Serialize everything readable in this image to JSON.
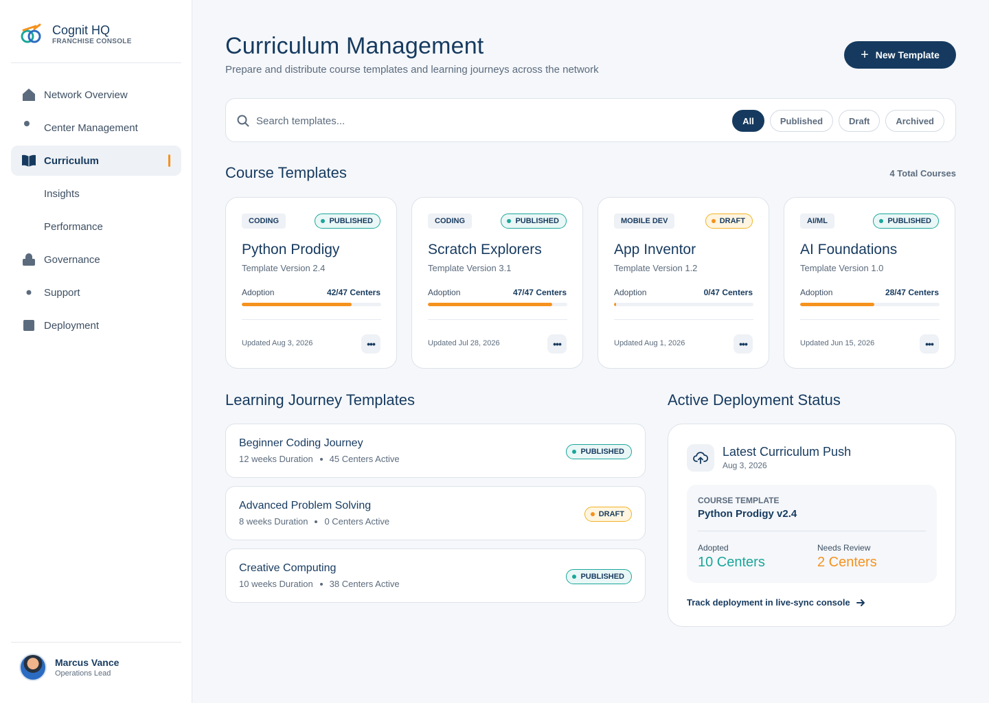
{
  "brand": {
    "title": "Cognit HQ",
    "subtitle": "FRANCHISE CONSOLE"
  },
  "sidebar": {
    "items": [
      {
        "label": "Network Overview",
        "icon": "home-icon"
      },
      {
        "label": "Center Management",
        "icon": "dot-icon"
      },
      {
        "label": "Curriculum",
        "icon": "book-icon",
        "active": true
      },
      {
        "label": "Insights",
        "icon": "none"
      },
      {
        "label": "Performance",
        "icon": "none"
      },
      {
        "label": "Governance",
        "icon": "lock-icon"
      },
      {
        "label": "Support",
        "icon": "dot-icon"
      },
      {
        "label": "Deployment",
        "icon": "square-icon"
      }
    ]
  },
  "user": {
    "name": "Marcus Vance",
    "role": "Operations Lead"
  },
  "header": {
    "title": "Curriculum Management",
    "subtitle": "Prepare and distribute course templates and learning journeys across the network",
    "new_button": "New Template"
  },
  "search": {
    "placeholder": "Search templates..."
  },
  "filters": [
    "All",
    "Published",
    "Draft",
    "Archived"
  ],
  "course_section": {
    "title": "Course Templates",
    "total": "4 Total Courses"
  },
  "courses": [
    {
      "tag": "CODING",
      "status": "PUBLISHED",
      "name": "Python Prodigy",
      "version": "Template Version 2.4",
      "adoption_label": "Adoption",
      "adoption": "42/47 Centers",
      "adoption_fraction": 0.79,
      "updated": "Updated Aug 3, 2026"
    },
    {
      "tag": "CODING",
      "status": "PUBLISHED",
      "name": "Scratch Explorers",
      "version": "Template Version 3.1",
      "adoption_label": "Adoption",
      "adoption": "47/47 Centers",
      "adoption_fraction": 0.89,
      "updated": "Updated Jul 28, 2026"
    },
    {
      "tag": "MOBILE DEV",
      "status": "DRAFT",
      "name": "App Inventor",
      "version": "Template Version 1.2",
      "adoption_label": "Adoption",
      "adoption": "0/47 Centers",
      "adoption_fraction": 0.015,
      "updated": "Updated Aug 1, 2026"
    },
    {
      "tag": "AI/ML",
      "status": "PUBLISHED",
      "name": "AI Foundations",
      "version": "Template Version 1.0",
      "adoption_label": "Adoption",
      "adoption": "28/47 Centers",
      "adoption_fraction": 0.53,
      "updated": "Updated Jun 15, 2026"
    }
  ],
  "journey_section": {
    "title": "Learning Journey Templates"
  },
  "journeys": [
    {
      "name": "Beginner Coding Journey",
      "duration": "12 weeks Duration",
      "active": "45 Centers Active",
      "status": "PUBLISHED"
    },
    {
      "name": "Advanced Problem Solving",
      "duration": "8 weeks Duration",
      "active": "0 Centers Active",
      "status": "DRAFT"
    },
    {
      "name": "Creative Computing",
      "duration": "10 weeks Duration",
      "active": "38 Centers Active",
      "status": "PUBLISHED"
    }
  ],
  "deployment": {
    "section_title": "Active Deployment Status",
    "title": "Latest Curriculum Push",
    "date": "Aug 3, 2026",
    "course_template_label": "COURSE TEMPLATE",
    "course_template_value": "Python Prodigy v2.4",
    "adopted_label": "Adopted",
    "adopted_value": "10 Centers",
    "review_label": "Needs Review",
    "review_value": "2 Centers",
    "link": "Track deployment in live-sync console"
  },
  "colors": {
    "primary": "#163a5f",
    "accent": "#f5921e",
    "teal": "#1aa69a",
    "draft_border": "#f0b324"
  }
}
